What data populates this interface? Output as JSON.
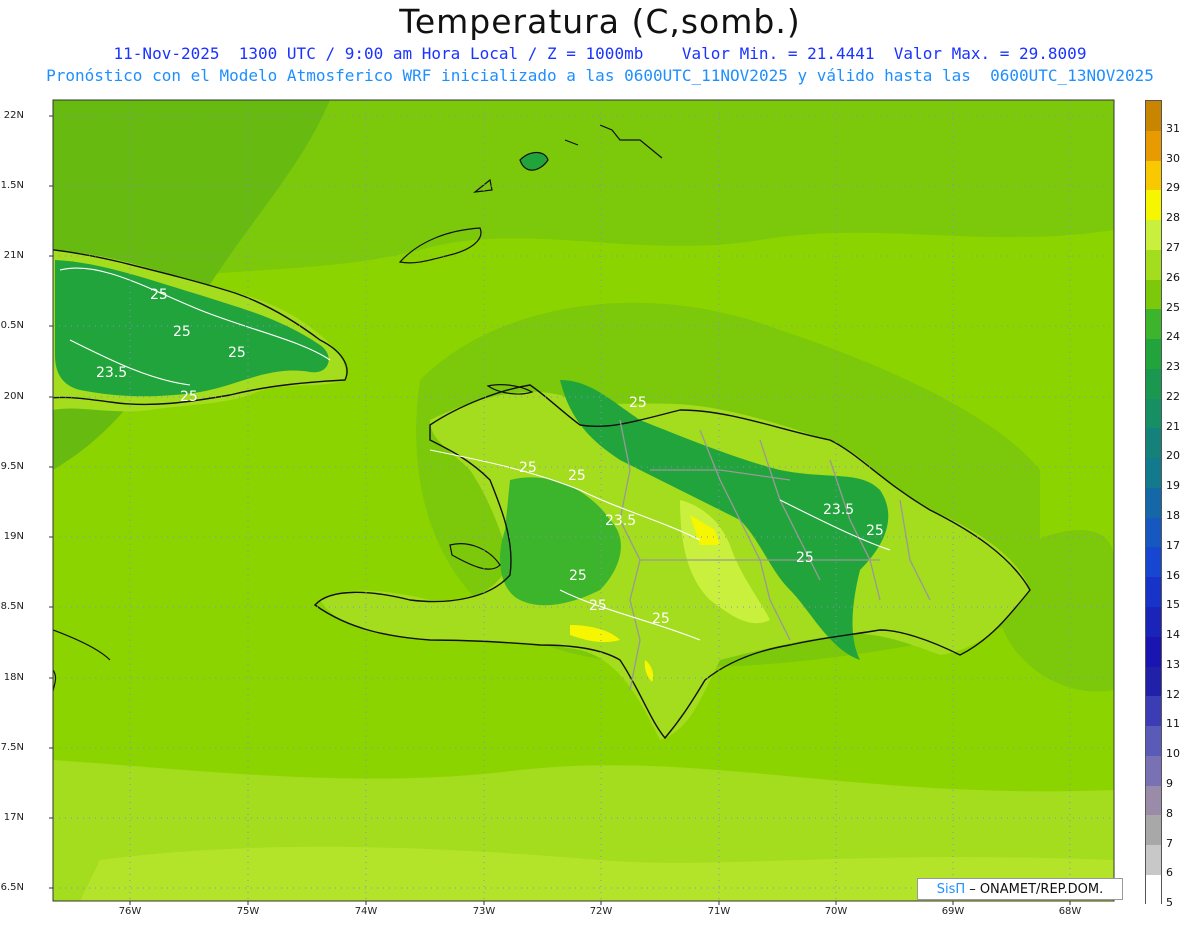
{
  "title": "Temperatura (C,somb.)",
  "subtitle_line1": "11-Nov-2025  1300 UTC / 9:00 am Hora Local / Z = 1000mb    Valor Min. = 21.4441  Valor Max. = 29.8009",
  "subtitle_line2": "Pronóstico con el Modelo Atmosferico WRF inicializado a las 0600UTC_11NOV2025 y válido hasta las  0600UTC_13NOV2025",
  "lat_labels": [
    "22N",
    "1.5N",
    "21N",
    "0.5N",
    "20N",
    "9.5N",
    "19N",
    "8.5N",
    "18N",
    "7.5N",
    "17N",
    "6.5N"
  ],
  "lon_labels": [
    "76W",
    "75W",
    "74W",
    "73W",
    "72W",
    "71W",
    "70W",
    "69W",
    "68W"
  ],
  "colorbar": {
    "levels": [
      "31",
      "30",
      "29",
      "28",
      "27",
      "26",
      "25",
      "24",
      "23",
      "22",
      "21",
      "20",
      "19",
      "18",
      "17",
      "16",
      "15",
      "14",
      "13",
      "12",
      "11",
      "10",
      "9",
      "8",
      "7",
      "6",
      "5"
    ],
    "colors": [
      "#c98500",
      "#e89b00",
      "#f8c800",
      "#f6f600",
      "#c8f03c",
      "#a4dc1e",
      "#7cc80a",
      "#3cb42c",
      "#22a43c",
      "#1a9850",
      "#178f64",
      "#14827a",
      "#137a8e",
      "#1468a8",
      "#1658c0",
      "#1746d0",
      "#1834c8",
      "#1a24b8",
      "#1a14b0",
      "#2020a8",
      "#3c3cb4",
      "#5a5ab8",
      "#7a70b4",
      "#9a8ca8",
      "#a8a8a8",
      "#c8c8c8",
      "#ffffff"
    ]
  },
  "contour_labels": [
    "25",
    "25",
    "25",
    "23.5",
    "25",
    "25",
    "25",
    "25",
    "23.5",
    "25",
    "25",
    "25",
    "23.5",
    "25",
    "25"
  ],
  "credit": {
    "sis": "SisΠ",
    "ona": "– ONAMET/REP.DOM."
  },
  "colors": {
    "ocean": "#8cd400",
    "land_warm": "#a4dc1e",
    "land_cool": "#3cb42c",
    "coast": "#111111",
    "border": "#999999"
  }
}
